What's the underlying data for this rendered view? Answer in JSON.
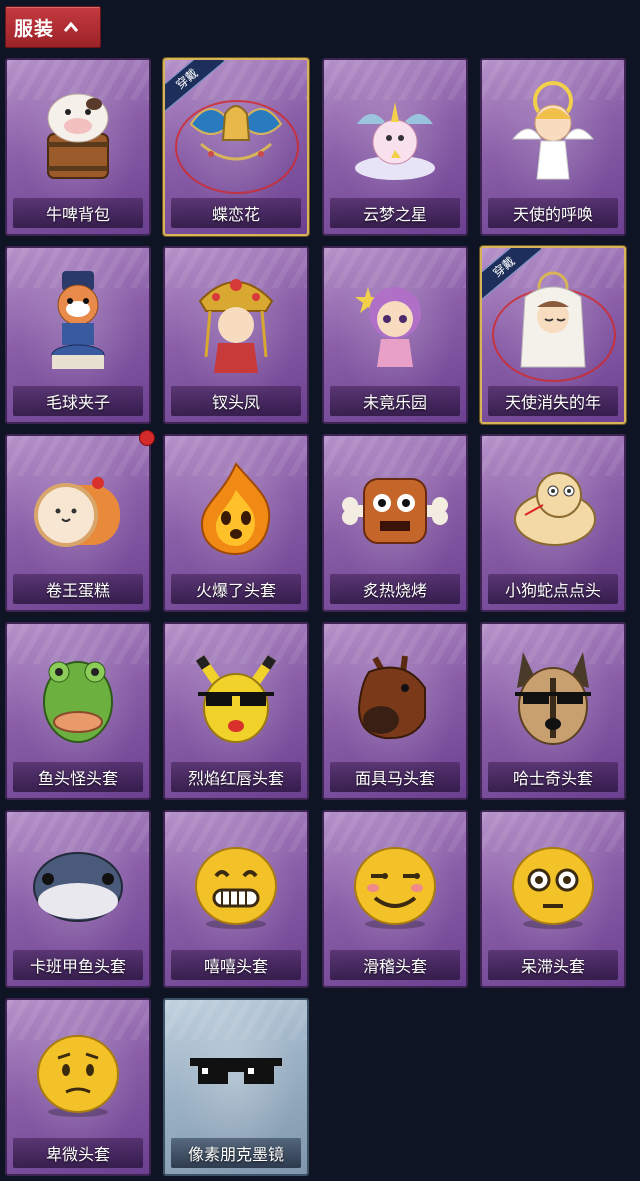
{
  "header": {
    "title": "服装"
  },
  "colors": {
    "card_purple": "#8a5fa8",
    "card_blue": "#9cb2c5",
    "equipped_gold": "#d7b35a",
    "badge_red": "#d42a2a",
    "header_red": "#b12e33",
    "background": "#0f1424"
  },
  "items": [
    {
      "label": "牛啤背包",
      "icon": "cow-beer-barrel-icon",
      "equipped": false
    },
    {
      "label": "蝶恋花",
      "icon": "butterfly-bell-ornament-icon",
      "equipped": true,
      "badge": "穿戴"
    },
    {
      "label": "云梦之星",
      "icon": "unicorn-cloud-icon",
      "equipped": false
    },
    {
      "label": "天使的呼唤",
      "icon": "angel-doll-icon",
      "equipped": false
    },
    {
      "label": "毛球夹子",
      "icon": "raccoon-drummer-icon",
      "equipped": false
    },
    {
      "label": "钗头凤",
      "icon": "phoenix-crown-doll-icon",
      "equipped": false
    },
    {
      "label": "未竟乐园",
      "icon": "fairy-doll-icon",
      "equipped": false
    },
    {
      "label": "天使消失的年",
      "icon": "veiled-doll-icon",
      "equipped": true,
      "badge": "穿戴"
    },
    {
      "label": "卷王蛋糕",
      "icon": "cake-roll-icon",
      "equipped": false,
      "new": true
    },
    {
      "label": "火爆了头套",
      "icon": "fire-spirit-icon",
      "equipped": false
    },
    {
      "label": "炙热烧烤",
      "icon": "meat-bone-icon",
      "equipped": false
    },
    {
      "label": "小狗蛇点点头",
      "icon": "snake-dog-icon",
      "equipped": false
    },
    {
      "label": "鱼头怪头套",
      "icon": "fish-head-mask-icon",
      "equipped": false
    },
    {
      "label": "烈焰红唇头套",
      "icon": "pikachu-mask-icon",
      "equipped": false
    },
    {
      "label": "面具马头套",
      "icon": "horse-mask-icon",
      "equipped": false
    },
    {
      "label": "哈士奇头套",
      "icon": "husky-mask-icon",
      "equipped": false
    },
    {
      "label": "卡班甲鱼头套",
      "icon": "whale-fish-mask-icon",
      "equipped": false
    },
    {
      "label": "嘻嘻头套",
      "icon": "grin-emoji-icon",
      "equipped": false
    },
    {
      "label": "滑稽头套",
      "icon": "funny-emoji-icon",
      "equipped": false
    },
    {
      "label": "呆滞头套",
      "icon": "dazed-emoji-icon",
      "equipped": false
    },
    {
      "label": "卑微头套",
      "icon": "humble-emoji-icon",
      "equipped": false
    },
    {
      "label": "像素朋克墨镜",
      "icon": "pixel-sunglasses-icon",
      "equipped": false,
      "blue": true
    }
  ]
}
